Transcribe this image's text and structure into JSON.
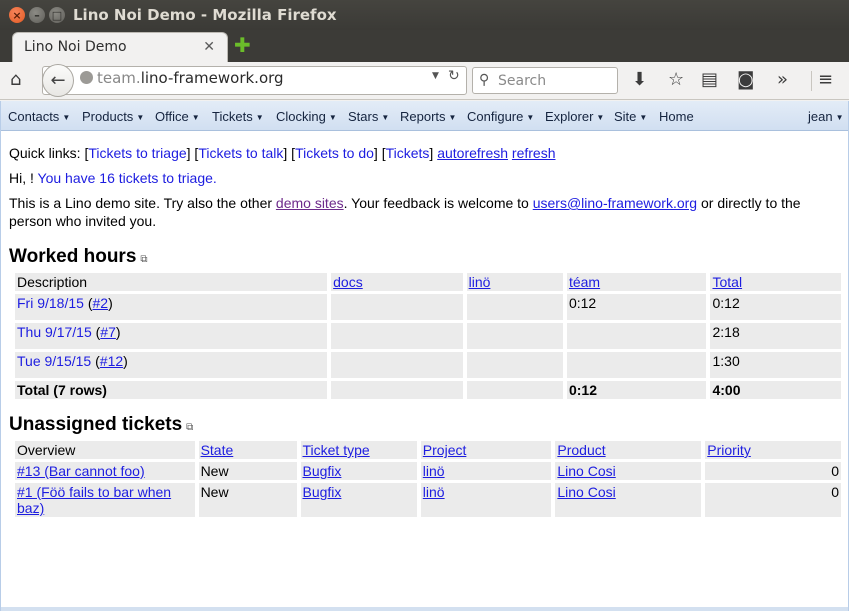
{
  "window": {
    "title": "Lino Noi Demo - Mozilla Firefox"
  },
  "tab": {
    "title": "Lino Noi Demo",
    "close": "✕",
    "new_tab": "✚"
  },
  "toolbar": {
    "url_host_prefix": "team.",
    "url_host_rest": "lino-framework.org",
    "search_placeholder": "Search"
  },
  "menu": {
    "items": [
      "Contacts",
      "Products",
      "Office",
      "Tickets",
      "Clocking",
      "Stars",
      "Reports",
      "Configure",
      "Explorer",
      "Site",
      "Home"
    ],
    "user": "jean"
  },
  "quick_links": {
    "prefix": "Quick links: ",
    "triage": "Tickets to triage",
    "talk": "Tickets to talk",
    "todo": "Tickets to do",
    "tickets": "Tickets",
    "autorefresh": "autorefresh",
    "refresh": "refresh"
  },
  "greeting": {
    "hi": "Hi, ! ",
    "triage_msg": "You have 16 tickets to triage."
  },
  "intro": {
    "p1": "This is a Lino demo site. Try also the other ",
    "demo_sites": "demo sites",
    "p2": ". Your feedback is welcome to ",
    "email": "users@lino-framework.org",
    "p3": " or directly to the",
    "p4": "person who invited you."
  },
  "worked_hours": {
    "title": "Worked hours",
    "columns": [
      "Description",
      "docs",
      "linö",
      "téam",
      "Total"
    ],
    "rows": [
      {
        "date": "Fri 9/18/15",
        "ticket": "#2",
        "docs": "",
        "lino": "",
        "team": "0:12",
        "total": "0:12"
      },
      {
        "date": "Thu 9/17/15",
        "ticket": "#7",
        "docs": "",
        "lino": "",
        "team": "",
        "total": "2:18"
      },
      {
        "date": "Tue 9/15/15",
        "ticket": "#12",
        "docs": "",
        "lino": "",
        "team": "",
        "total": "1:30"
      }
    ],
    "total_row": {
      "label": "Total (7 rows)",
      "team": "0:12",
      "total": "4:00"
    }
  },
  "unassigned": {
    "title": "Unassigned tickets",
    "columns": [
      "Overview",
      "State",
      "Ticket type",
      "Project",
      "Product",
      "Priority"
    ],
    "rows": [
      {
        "overview": "#13 (Bar cannot foo)",
        "state": "New",
        "type": "Bugfix",
        "project": "linö",
        "product": "Lino Cosi",
        "priority": "0"
      },
      {
        "overview_1": "#1 (Föö fails to bar when",
        "overview_2": "baz)",
        "state": "New",
        "type": "Bugfix",
        "project": "linö",
        "product": "Lino Cosi",
        "priority": "0"
      }
    ]
  }
}
